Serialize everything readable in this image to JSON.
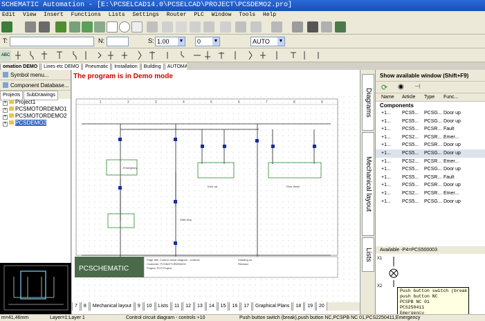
{
  "window": {
    "title": "SCHEMATIC Automation - [E:\\PCSELCAD14.0\\PCSELCAD\\PROJECT\\PCSDEMO2.pro]"
  },
  "menu": [
    "Edit",
    "View",
    "Insert",
    "Functions",
    "Lists",
    "Settings",
    "Router",
    "PLC",
    "Window",
    "Tools",
    "Help"
  ],
  "toolbar2": {
    "t_label": "T:",
    "n_label": "N:",
    "s_label": "S:",
    "s_value": "1.00",
    "layer_value": "0",
    "auto_value": "AUTO"
  },
  "toolbar3": {
    "abc_label": "ABC"
  },
  "tabs": [
    "omation DEMO",
    "Lines etc DEMO",
    "Pneumatic",
    "Installation",
    "Building",
    "AUTOMATION"
  ],
  "left_panel": {
    "symbol_menu": "Symbol menu...",
    "component_db": "Component Database...",
    "tabs": [
      "Projects",
      "SubDrawings"
    ],
    "tree": [
      "Project1",
      "PCSMOTORDEMO1",
      "PCSMOTORDEMO2",
      "PCSDEMO2"
    ]
  },
  "main": {
    "demo_text": "The program is in Demo mode"
  },
  "drawing": {
    "logo": "PCSCHEMATIC",
    "sub_labels": [
      "Emergency",
      "Start stop",
      "Door up",
      "Door down"
    ],
    "title_block": [
      "Page title: Control circuit diagram - controls",
      "Customer: PCSMOTORDEMO2",
      "Project: PCS Project",
      "Drawing no.",
      "Revision"
    ],
    "columns": [
      "1",
      "2",
      "3",
      "4",
      "5",
      "6",
      "7",
      "8",
      "9"
    ]
  },
  "bottom_tabs": [
    "7",
    "8",
    "Mechanical layout",
    "9",
    "10",
    "Lists",
    "11",
    "12",
    "13",
    "14",
    "15",
    "16",
    "17",
    "Graphical Plans",
    "18",
    "19",
    "20"
  ],
  "vertical_tabs": [
    "Diagrams",
    "Mechanical layout",
    "Lists"
  ],
  "right_panel": {
    "title": "Show available window (Shift+F9)",
    "columns": [
      "Name",
      "Article",
      "Type",
      "Func..."
    ],
    "group": "Components",
    "rows": [
      {
        "name": "+1...",
        "article": "PCS5...",
        "type": "PCSG...",
        "func": "Door up"
      },
      {
        "name": "+1...",
        "article": "PCS5...",
        "type": "PCSG...",
        "func": "Door up"
      },
      {
        "name": "+1...",
        "article": "PCS5...",
        "type": "PCSR...",
        "func": "Fault"
      },
      {
        "name": "+1...",
        "article": "PCS2...",
        "type": "PCSR...",
        "func": "Emer..."
      },
      {
        "name": "+1...",
        "article": "PCS5...",
        "type": "PCSR...",
        "func": "Door up"
      },
      {
        "name": "+1...",
        "article": "PCS5...",
        "type": "PCSG...",
        "func": "Door up"
      },
      {
        "name": "+1...",
        "article": "PCS2...",
        "type": "PCSR...",
        "func": "Emer..."
      },
      {
        "name": "+1...",
        "article": "PCS5...",
        "type": "PCSG...",
        "func": "Door up"
      },
      {
        "name": "+1...",
        "article": "PCS5...",
        "type": "PCSR...",
        "func": "Fault"
      },
      {
        "name": "+1...",
        "article": "PCS5...",
        "type": "PCSR...",
        "func": "Door up"
      },
      {
        "name": "+1...",
        "article": "PCS2...",
        "type": "PCSR...",
        "func": "Emer..."
      },
      {
        "name": "+1...",
        "article": "PCS5...",
        "type": "PCSG...",
        "func": "Door up"
      }
    ],
    "available": "Available -P4=PCS500003",
    "preview_labels": [
      "X1",
      "X2"
    ]
  },
  "tooltip": [
    "Push button switch (break)",
    "push button NC",
    "PCSPB NC 01",
    "PCS250411",
    "Emergency"
  ],
  "status": {
    "coords": "m=41,46mm",
    "layer": "Layer=1:Layer 1",
    "page": "Control circuit diagram - controls +10",
    "symbol": "Push button switch (break),push button NC,PCSPB NC 01,PCS2250411,Emergency"
  }
}
